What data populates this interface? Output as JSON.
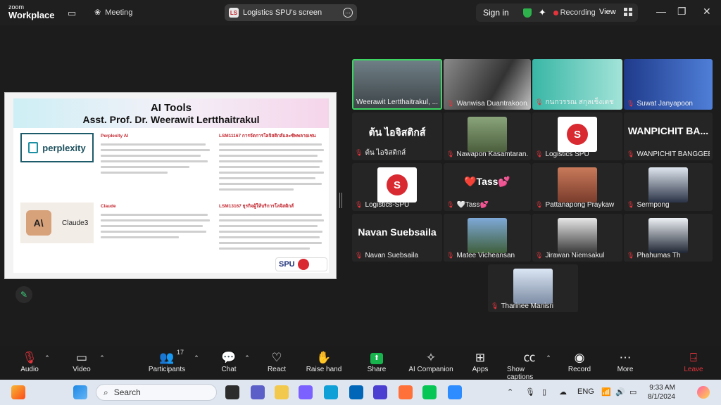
{
  "titlebar": {
    "logo_line1": "zoom",
    "logo_line2": "Workplace",
    "meeting_label": "Meeting",
    "share_title": "Logistics SPU's screen",
    "signin": "Sign in",
    "recording": "Recording",
    "view": "View"
  },
  "slide": {
    "title": "AI Tools",
    "subtitle": "Asst. Prof. Dr. Weerawit Lertthaitrakul",
    "perplexity_logo": "perplexity",
    "perplexity_heading": "Perplexity AI",
    "lsm1_heading": "LSM11167 การจัดการโลจิสติกส์และซัพพลายเชน",
    "claude_logo_text": "Claude3",
    "claude_heading": "Claude",
    "lsm2_heading": "LSM13167 ธุรกิจผู้ให้บริการโลจิสติกส์",
    "badge": "SPU"
  },
  "gallery": {
    "tiles": [
      {
        "name": "Weerawit Lertthaitrakul, ...",
        "muted": false
      },
      {
        "name": "Wanwisa Duantrakoon...",
        "muted": true
      },
      {
        "name": "กนกวรรณ สกุลเช็งเดช",
        "muted": true
      },
      {
        "name": "Suwat Janyapoon",
        "muted": true
      },
      {
        "name": "ต้น ไอจิสติกส์",
        "bigname": "ต้น ไอจิสติกส์",
        "muted": true
      },
      {
        "name": "Nawapon Kasamtaran...",
        "muted": true
      },
      {
        "name": "Logistics SPU",
        "muted": true
      },
      {
        "name": "WANPICHIT BANGGEEN",
        "bigname": "WANPICHIT BA...",
        "muted": true
      },
      {
        "name": "Logistics-SPU",
        "muted": true
      },
      {
        "name": "🤍Tass💕",
        "bigname": "❤️Tass💕",
        "muted": true
      },
      {
        "name": "Pattanapong Praykaw",
        "muted": true
      },
      {
        "name": "Sermpong",
        "muted": true
      },
      {
        "name": "Navan Suebsaila",
        "bigname": "Navan Suebsaila",
        "muted": true
      },
      {
        "name": "Matee Vicheansan",
        "muted": true
      },
      {
        "name": "Jirawan Niemsakul",
        "muted": true
      },
      {
        "name": "Phahumas Th",
        "muted": true
      },
      {
        "name": "Tharinee Manisri",
        "muted": true
      }
    ]
  },
  "toolbar": {
    "audio": "Audio",
    "video": "Video",
    "participants": "Participants",
    "participant_count": "17",
    "chat": "Chat",
    "react": "React",
    "raise_hand": "Raise hand",
    "share": "Share",
    "ai_companion": "AI Companion",
    "apps": "Apps",
    "captions": "Show captions",
    "record": "Record",
    "more": "More",
    "leave": "Leave"
  },
  "taskbar": {
    "search": "Search",
    "lang": "ENG",
    "time": "9:33 AM",
    "date": "8/1/2024"
  },
  "colors": {
    "accent_green": "#3dd662",
    "recording_red": "#e3343c",
    "spu_red": "#d92a31"
  }
}
